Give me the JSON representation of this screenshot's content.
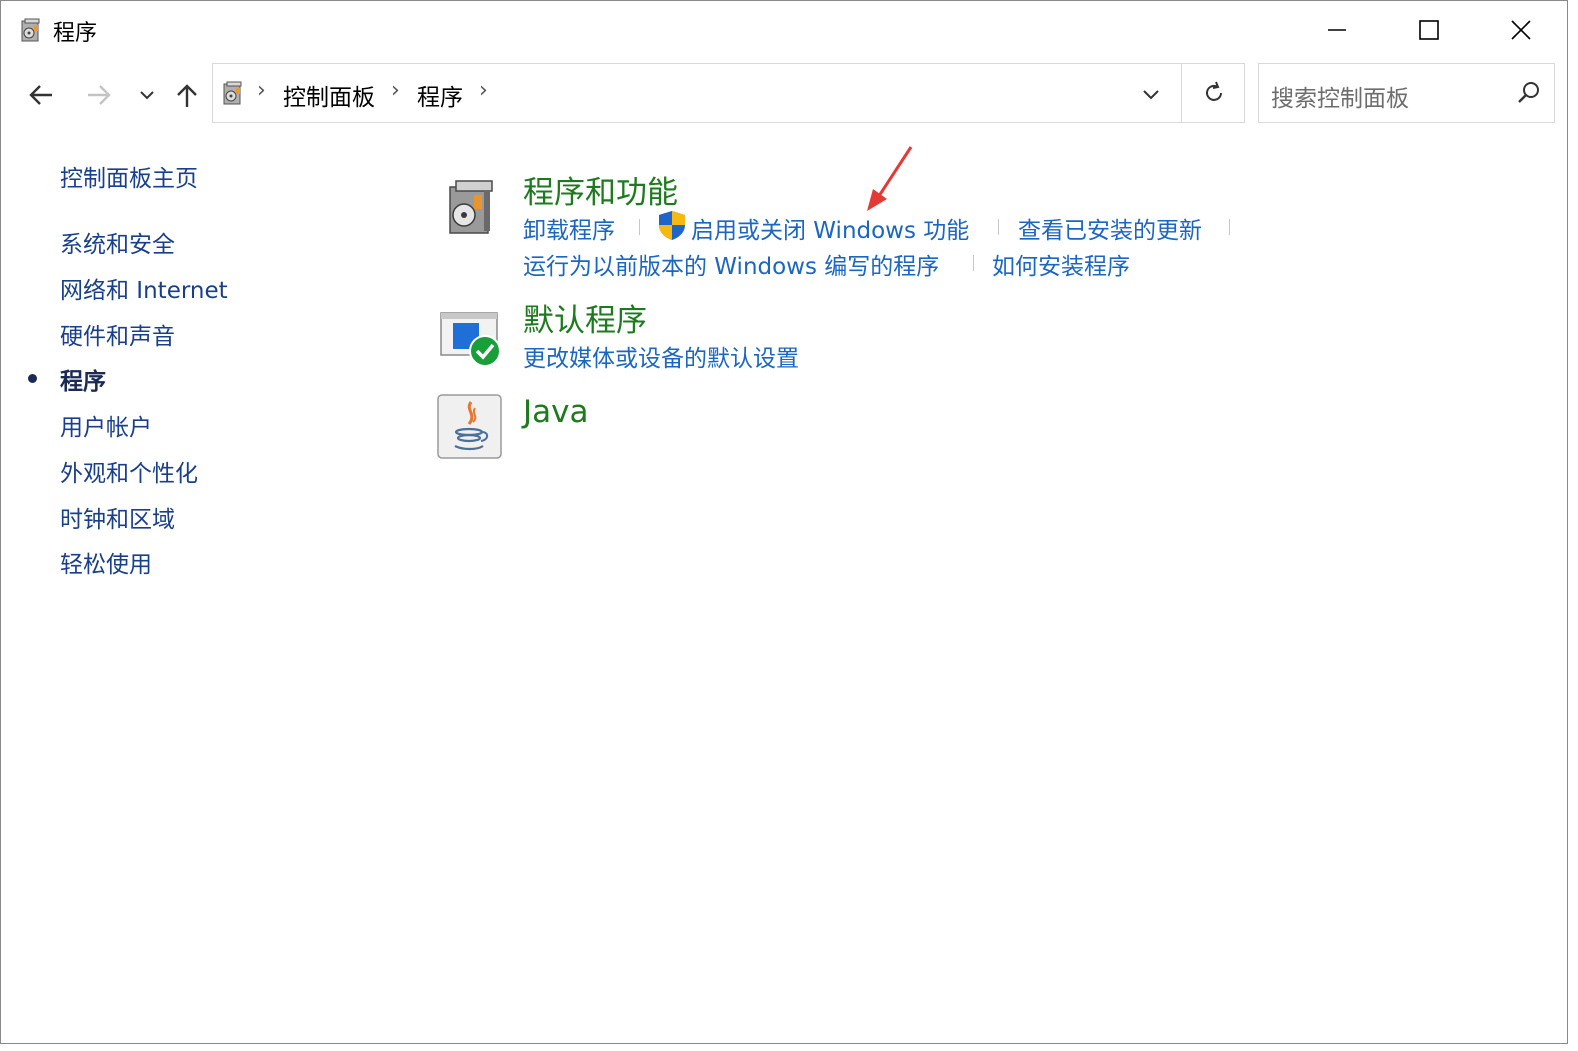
{
  "window": {
    "title": "程序",
    "controls": {
      "minimize": "minimize",
      "maximize": "maximize",
      "close": "close"
    }
  },
  "nav": {
    "back": "back-arrow",
    "forward": "forward-arrow",
    "recent": "chevron-down",
    "up": "up-arrow"
  },
  "address": {
    "crumbs": [
      "控制面板",
      "程序"
    ]
  },
  "search": {
    "placeholder": "搜索控制面板"
  },
  "sidebar": {
    "home": "控制面板主页",
    "items": [
      {
        "label": "系统和安全",
        "active": false
      },
      {
        "label": "网络和 Internet",
        "active": false
      },
      {
        "label": "硬件和声音",
        "active": false
      },
      {
        "label": "程序",
        "active": true
      },
      {
        "label": "用户帐户",
        "active": false
      },
      {
        "label": "外观和个性化",
        "active": false
      },
      {
        "label": "时钟和区域",
        "active": false
      },
      {
        "label": "轻松使用",
        "active": false
      }
    ]
  },
  "categories": {
    "programs_features": {
      "title": "程序和功能",
      "links": {
        "uninstall": "卸载程序",
        "windows_features": "启用或关闭 Windows 功能",
        "view_updates": "查看已安装的更新",
        "compat": "运行为以前版本的 Windows 编写的程序",
        "how_install": "如何安装程序"
      }
    },
    "default_programs": {
      "title": "默认程序",
      "links": {
        "change_defaults": "更改媒体或设备的默认设置"
      }
    },
    "java": {
      "title": "Java"
    }
  },
  "colors": {
    "category_title": "#1e7a1e",
    "link": "#1a66c0",
    "sidebar_link": "#1a3f8a",
    "annotation_arrow": "#e53935"
  }
}
